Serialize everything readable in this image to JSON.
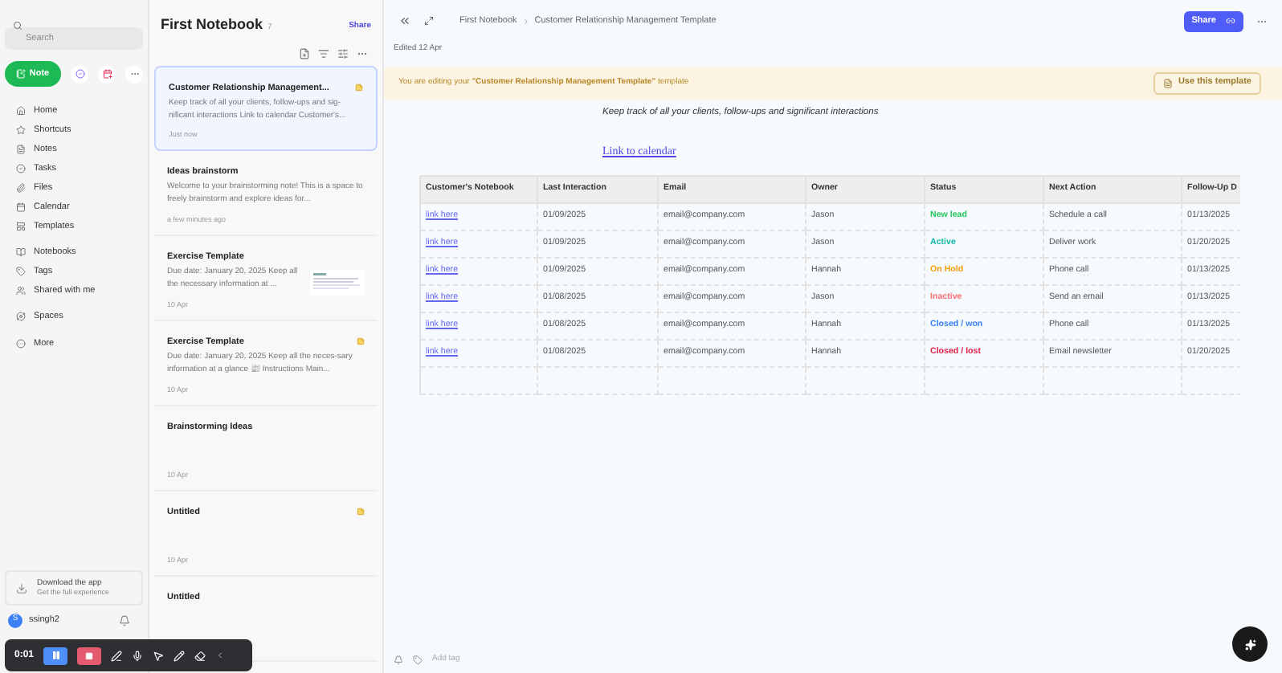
{
  "sidebar": {
    "search": {
      "placeholder": "Search"
    },
    "new_note": "Note",
    "nav": [
      [
        "Home",
        "Shortcuts",
        "Notes",
        "Tasks",
        "Files",
        "Calendar",
        "Templates"
      ],
      [
        "Notebooks",
        "Tags",
        "Shared with me"
      ],
      [
        "Spaces"
      ],
      [
        "More"
      ]
    ],
    "download": {
      "title": "Download the app",
      "subtitle": "Get the full experience"
    },
    "user": {
      "initial": "S",
      "name": "ssingh2"
    }
  },
  "note_list": {
    "title": "First Notebook",
    "count": "7",
    "share": "Share",
    "notes": [
      {
        "title": "Customer Relationship Management...",
        "snippet": "Keep track of all your clients, follow-ups and sig-nificant interactions Link to calendar Customer's...",
        "date": "Just now",
        "badge": true,
        "thumbnail": false,
        "selected": true
      },
      {
        "title": "Ideas brainstorm",
        "snippet": "Welcome to your brainstorming note! This is a space to freely brainstorm and explore ideas for...",
        "date": "a few minutes ago",
        "badge": false,
        "thumbnail": false,
        "selected": false
      },
      {
        "title": "Exercise Template",
        "snippet": "Due date: January 20, 2025 Keep all the necessary information at ...",
        "date": "10 Apr",
        "badge": false,
        "thumbnail": true,
        "selected": false
      },
      {
        "title": "Exercise Template",
        "snippet": "Due date: January 20, 2025 Keep all the neces-sary information at a glance 📰 Instructions Main...",
        "date": "10 Apr",
        "badge": true,
        "thumbnail": false,
        "selected": false
      },
      {
        "title": "Brainstorming Ideas",
        "date": "10 Apr",
        "badge": false,
        "thumbnail": false,
        "selected": false
      },
      {
        "title": "Untitled",
        "date": "10 Apr",
        "badge": true,
        "thumbnail": false,
        "selected": false
      },
      {
        "title": "Untitled",
        "badge": false,
        "thumbnail": false,
        "selected": false
      }
    ]
  },
  "recorder": {
    "time": "0:01"
  },
  "editor": {
    "breadcrumb": [
      "First Notebook",
      "Customer Relationship Management Template"
    ],
    "share": "Share",
    "edited": "Edited 12 Apr",
    "banner": {
      "text": "You are editing your **\"Customer Relationship Management Template\"** template",
      "button": "Use this template"
    },
    "intro": "Keep track of all your clients, follow-ups and significant interactions",
    "link": "Link to calendar",
    "table": {
      "columns": [
        "Customer's Notebook",
        "Last Interaction",
        "Email",
        "Owner",
        "Status",
        "Next Action",
        "Follow-Up D"
      ],
      "rows": [
        {
          "link": "link here",
          "last": "01/09/2025",
          "email": "email@company.com",
          "owner": "Jason",
          "status": "New lead",
          "color": "#22c55e",
          "action": "Schedule a call",
          "follow": "01/13/2025"
        },
        {
          "link": "link here",
          "last": "01/09/2025",
          "email": "email@company.com",
          "owner": "Jason",
          "status": "Active",
          "color": "#14b8a6",
          "action": "Deliver work",
          "follow": "01/20/2025"
        },
        {
          "link": "link here",
          "last": "01/09/2025",
          "email": "email@company.com",
          "owner": "Hannah",
          "status": "On Hold",
          "color": "#f59e0b",
          "action": "Phone call",
          "follow": "01/13/2025"
        },
        {
          "link": "link here",
          "last": "01/08/2025",
          "email": "email@company.com",
          "owner": "Jason",
          "status": "Inactive",
          "color": "#f87171",
          "action": "Send an email",
          "follow": "01/13/2025"
        },
        {
          "link": "link here",
          "last": "01/08/2025",
          "email": "email@company.com",
          "owner": "Hannah",
          "status": "Closed / won",
          "color": "#3b82f6",
          "action": "Phone call",
          "follow": "01/13/2025"
        },
        {
          "link": "link here",
          "last": "01/08/2025",
          "email": "email@company.com",
          "owner": "Hannah",
          "status": "Closed / lost",
          "color": "#e11d48",
          "action": "Email newsletter",
          "follow": "01/20/2025"
        }
      ]
    },
    "add_tag": "Add tag"
  }
}
